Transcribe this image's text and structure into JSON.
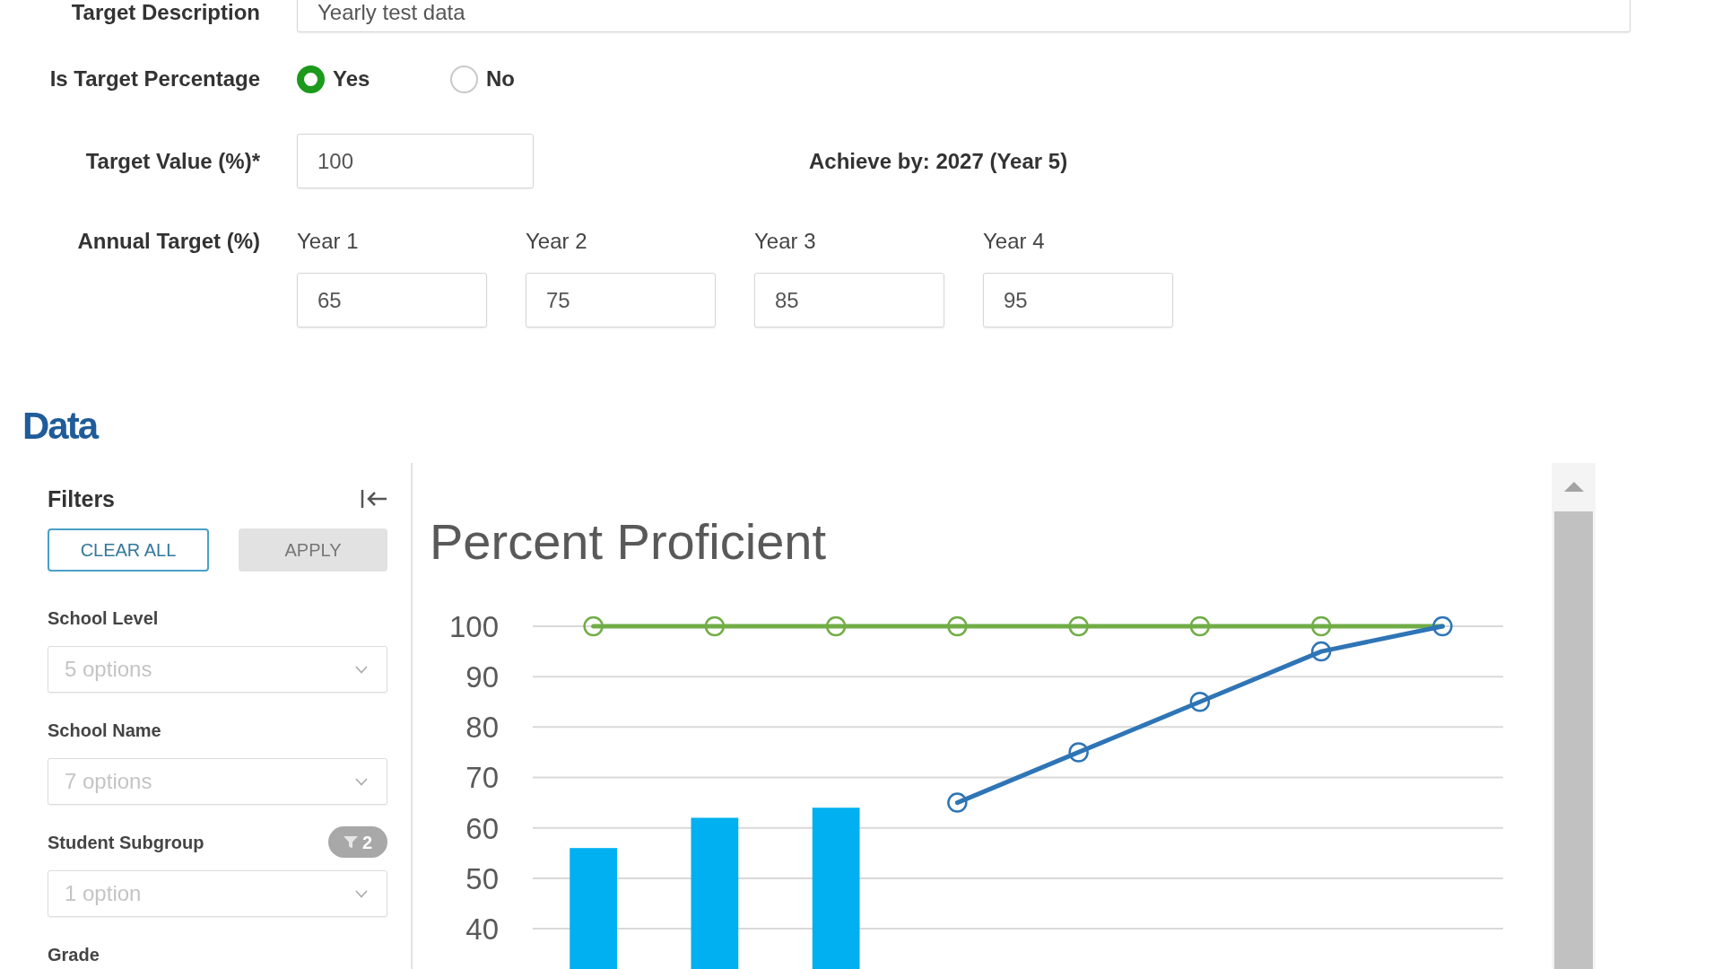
{
  "form": {
    "target_description": {
      "label": "Target Description",
      "value": "Yearly test data"
    },
    "is_target_percentage": {
      "label": "Is Target Percentage",
      "options": [
        {
          "label": "Yes",
          "selected": true
        },
        {
          "label": "No",
          "selected": false
        }
      ]
    },
    "target_value": {
      "label": "Target Value (%)*",
      "value": "100",
      "note": "Achieve by: 2027 (Year 5)"
    },
    "annual_target": {
      "label": "Annual Target (%)",
      "years": [
        {
          "label": "Year 1",
          "value": "65"
        },
        {
          "label": "Year 2",
          "value": "75"
        },
        {
          "label": "Year 3",
          "value": "85"
        },
        {
          "label": "Year 4",
          "value": "95"
        }
      ]
    }
  },
  "data": {
    "title": "Data",
    "filters": {
      "title": "Filters",
      "buttons": [
        {
          "label": "CLEAR ALL",
          "kind": "outline"
        },
        {
          "label": "APPLY",
          "kind": "muted"
        }
      ],
      "fields": [
        {
          "label": "School Level",
          "placeholder": "5 options"
        },
        {
          "label": "School Name",
          "placeholder": "7 options"
        },
        {
          "label": "Student Subgroup",
          "badge": "2",
          "placeholder": "1 option"
        },
        {
          "label": "Grade"
        }
      ]
    },
    "chart": {
      "chart_data": {
        "type": "line",
        "title": "Percent Proficient",
        "ylim": [
          32,
          100
        ],
        "yticks": [
          40,
          50,
          60,
          70,
          80,
          90,
          100
        ],
        "grid": true,
        "series": [
          {
            "type": "bar",
            "color": "#00b0f0",
            "values": [
              56,
              62,
              64,
              null,
              null,
              null,
              null,
              null
            ]
          },
          {
            "color": "#70ad47",
            "marker": "circle",
            "values": [
              100,
              100,
              100,
              100,
              100,
              100,
              100,
              100
            ]
          },
          {
            "color": "#2e75b6",
            "marker": "circle",
            "values": [
              null,
              null,
              null,
              65,
              75,
              85,
              95,
              100
            ]
          }
        ]
      }
    }
  }
}
